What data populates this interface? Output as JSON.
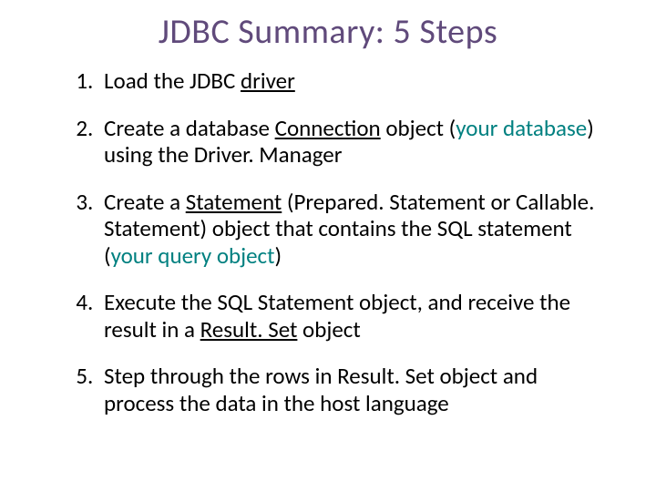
{
  "title": "JDBC Summary:  5 Steps",
  "steps": {
    "s1": {
      "a": "Load the JDBC ",
      "b": "driver"
    },
    "s2": {
      "a": "Create a database ",
      "b": "Connection",
      "c": " object (",
      "d": "your database",
      "e": ") using the Driver. Manager"
    },
    "s3": {
      "a": "Create a ",
      "b": "Statement",
      "c": " (Prepared. Statement or Callable. Statement) object that contains the SQL statement (",
      "d": "your query object",
      "e": ")"
    },
    "s4": {
      "a": "Execute the SQL Statement object, and receive the result in a ",
      "b": "Result. Set",
      "c": " object"
    },
    "s5": {
      "a": "Step through the rows in Result. Set object and process the data in the host language"
    }
  }
}
